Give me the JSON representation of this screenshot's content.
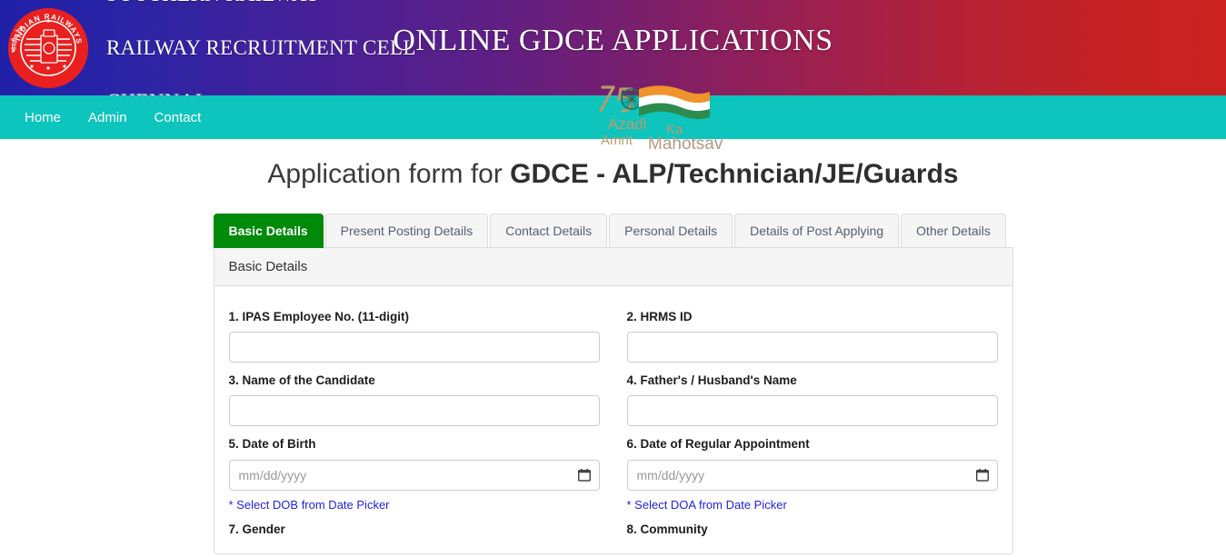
{
  "header": {
    "logo_alt": "indian-railways-emblem",
    "org_line1": "SOUTHERN RAILWAY",
    "org_line2": "RAILWAY RECRUITMENT CELL",
    "org_line3": "CHENNAI",
    "banner_title": "ONLINE GDCE APPLICATIONS",
    "gradient_start": "#2020a8",
    "gradient_mid": "#7a1f6c",
    "gradient_end": "#cb2121"
  },
  "nav": {
    "background": "#0dc5bd",
    "items": [
      {
        "label": "Home"
      },
      {
        "label": "Admin"
      },
      {
        "label": "Contact"
      }
    ]
  },
  "watermark": {
    "name": "azadi-ka-amrit-mahotsav-logo",
    "numeral": "75",
    "line1": "Azadi",
    "line2": "Ka",
    "line3": "Amrit",
    "line4": "Mahotsav"
  },
  "page": {
    "title_prefix": "Application form for ",
    "title_strong": "GDCE - ALP/Technician/JE/Guards"
  },
  "tabs": [
    {
      "label": "Basic Details",
      "active": true
    },
    {
      "label": "Present Posting Details",
      "active": false
    },
    {
      "label": "Contact Details",
      "active": false
    },
    {
      "label": "Personal Details",
      "active": false
    },
    {
      "label": "Details of Post Applying",
      "active": false
    },
    {
      "label": "Other Details",
      "active": false
    }
  ],
  "panel": {
    "heading": "Basic Details",
    "active_tab_color": "#008a09",
    "fields": {
      "ipas_label": "1. IPAS Employee No. (11-digit)",
      "ipas_value": "",
      "hrms_label": "2. HRMS ID",
      "hrms_value": "",
      "name_label": "3. Name of the Candidate",
      "name_value": "",
      "father_label": "4. Father's / Husband's Name",
      "father_value": "",
      "dob_label": "5. Date of Birth",
      "dob_placeholder": "mm/dd/yyyy",
      "dob_value": "",
      "dob_hint": "* Select DOB from Date Picker",
      "doa_label": "6. Date of Regular Appointment",
      "doa_placeholder": "mm/dd/yyyy",
      "doa_value": "",
      "doa_hint": "* Select DOA from Date Picker",
      "gender_label": "7. Gender",
      "community_label": "8. Community"
    }
  }
}
